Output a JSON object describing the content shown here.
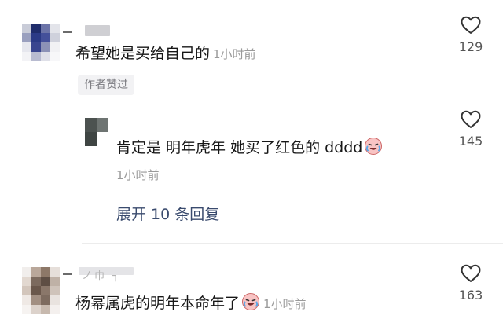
{
  "comments": [
    {
      "text": "希望她是买给自己的",
      "time": "1小时前",
      "likes": "129",
      "tag": "作者赞过"
    },
    {
      "text": "肯定是 明年虎年 她买了红色的 dddd",
      "time": "1小时前",
      "likes": "145",
      "expand": "展开 10 条回复"
    },
    {
      "name_partial": "ノ巾 ┐",
      "text": "杨幂属虎的明年本命年了",
      "time": "1小时前",
      "likes": "163"
    }
  ],
  "icons": {
    "like": "heart-outline-icon",
    "emoji": "crying-laughing-emoji-icon"
  },
  "colors": {
    "time": "#9a9a9a",
    "expand_link": "#3a4b6e",
    "tag_bg": "#f2f2f4"
  }
}
